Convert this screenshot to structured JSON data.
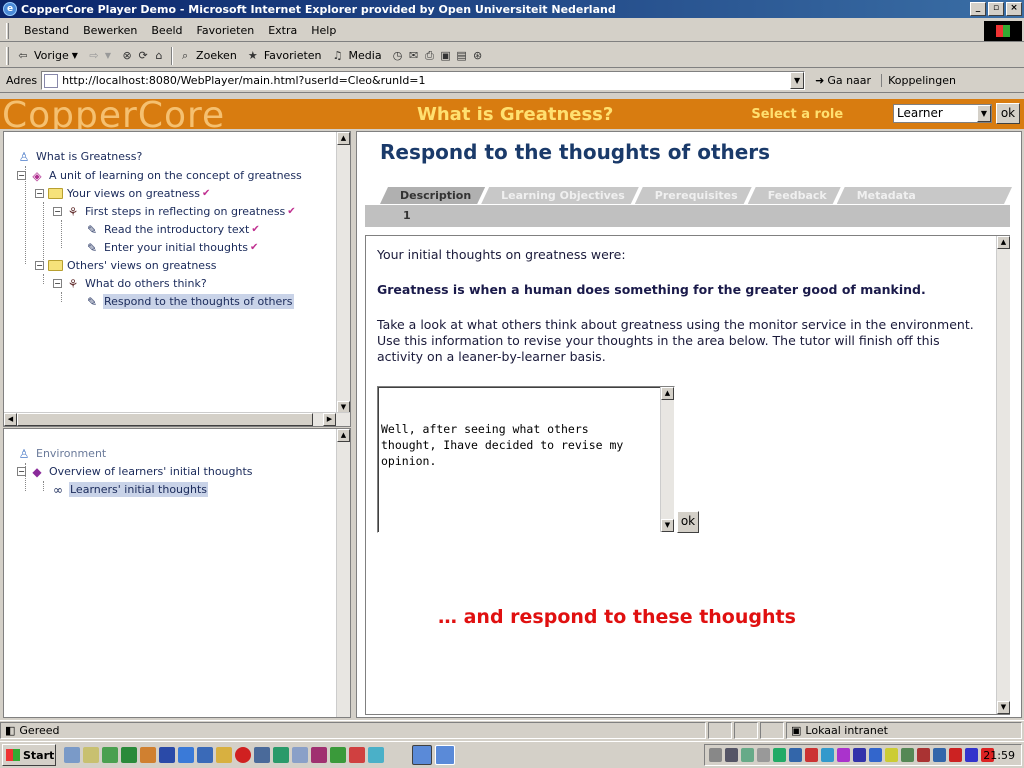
{
  "window": {
    "title": "CopperCore Player Demo - Microsoft Internet Explorer provided by Open Universiteit Nederland",
    "min": "_",
    "max": "▫",
    "close": "×"
  },
  "menu": [
    "Bestand",
    "Bewerken",
    "Beeld",
    "Favorieten",
    "Extra",
    "Help"
  ],
  "toolbar": {
    "back": "Vorige",
    "search": "Zoeken",
    "favorites": "Favorieten",
    "media": "Media"
  },
  "address": {
    "label": "Adres",
    "url": "http://localhost:8080/WebPlayer/main.html?userId=Cleo&runId=1",
    "go": "Ga naar",
    "links": "Koppelingen"
  },
  "app": {
    "logo": "CopperCore",
    "title": "What is Greatness?",
    "role_label": "Select a role",
    "role_value": "Learner",
    "ok": "ok"
  },
  "tree": {
    "root": "What is Greatness?",
    "unit": "A unit of learning on the concept of greatness",
    "your_views": "Your views on greatness",
    "first_steps": "First steps in reflecting on greatness",
    "read_intro": "Read the introductory text",
    "enter_thoughts": "Enter your initial thoughts",
    "others_views": "Others' views on greatness",
    "what_others": "What do others think?",
    "respond": "Respond to the thoughts of others"
  },
  "env": {
    "root": "Environment",
    "overview": "Overview of learners' initial thoughts",
    "learners": "Learners' initial thoughts"
  },
  "content": {
    "title": "Respond to the thoughts of others",
    "tabs": [
      "Description",
      "Learning Objectives",
      "Prerequisites",
      "Feedback",
      "Metadata"
    ],
    "sub": "1",
    "p1": "Your initial thoughts on greatness were:",
    "p2": "Greatness is when a human does something for the greater good of mankind.",
    "p3": "Take a look at what others think about greatness using the monitor service in the environment. Use this information to revise your thoughts in the area below. The tutor will finish off this activity on a leaner-by-learner basis.",
    "textarea": "Well, after seeing what others thought, Ihave decided to revise my opinion.",
    "ok": "ok",
    "annotation": "… and respond to these thoughts"
  },
  "status": {
    "text": "Gereed",
    "zone": "Lokaal intranet"
  },
  "taskbar": {
    "start": "Start",
    "clock": "21:59"
  }
}
